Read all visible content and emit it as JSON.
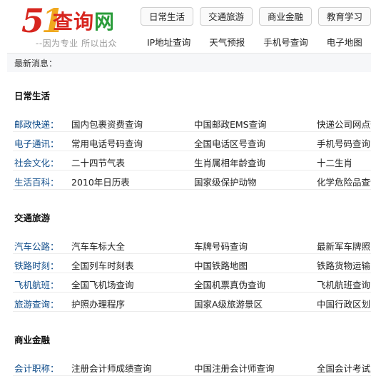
{
  "header": {
    "logo": {
      "num5": "5",
      "num1": "1",
      "text_cha_xun": "查询",
      "text_wang": "网"
    },
    "slogan": "--因为专业 所以出众",
    "nav": [
      "日常生活",
      "交通旅游",
      "商业金融",
      "教育学习"
    ],
    "subnav": [
      "IP地址查询",
      "天气预报",
      "手机号查询",
      "电子地图"
    ]
  },
  "notice": {
    "label": "最新消息："
  },
  "sections": [
    {
      "title": "日常生活",
      "rows": [
        {
          "label": "邮政快递：",
          "links": [
            "国内包裹资费查询",
            "中国邮政EMS查询",
            "快递公司网点查"
          ]
        },
        {
          "label": "电子通讯：",
          "links": [
            "常用电话号码查询",
            "全国电话区号查询",
            "手机号码查询"
          ]
        },
        {
          "label": "社会文化：",
          "links": [
            "二十四节气表",
            "生肖属相年龄查询",
            "十二生肖"
          ]
        },
        {
          "label": "生活百科：",
          "links": [
            "2010年日历表",
            "国家级保护动物",
            "化学危险品查询"
          ]
        }
      ]
    },
    {
      "title": "交通旅游",
      "rows": [
        {
          "label": "汽车公路：",
          "links": [
            "汽车车标大全",
            "车牌号码查询",
            "最新军车牌照"
          ]
        },
        {
          "label": "铁路时刻：",
          "links": [
            "全国列车时刻表",
            "中国铁路地图",
            "铁路货物运输"
          ]
        },
        {
          "label": "飞机航班：",
          "links": [
            "全国飞机场查询",
            "全国机票真伪查询",
            "飞机航班查询"
          ]
        },
        {
          "label": "旅游查询：",
          "links": [
            "护照办理程序",
            "国家A级旅游景区",
            "中国行政区划"
          ]
        }
      ]
    },
    {
      "title": "商业金融",
      "rows": [
        {
          "label": "会计职称：",
          "links": [
            "注册会计师成绩查询",
            "中国注册会计师查询",
            "全国会计考试成"
          ]
        }
      ]
    }
  ]
}
